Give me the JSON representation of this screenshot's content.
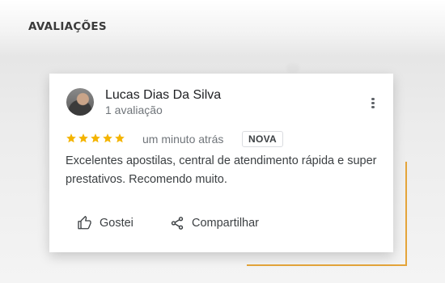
{
  "section": {
    "title": "AVALIAÇÕES"
  },
  "review": {
    "author": "Lucas Dias Da Silva",
    "review_count": "1 avaliação",
    "rating": 5,
    "star_color": "#f4b400",
    "time": "um minuto atrás",
    "badge": "NOVA",
    "text": "Excelentes apostilas, central de atendimento rápida e super prestativos. Recomendo muito.",
    "actions": {
      "like_label": "Gostei",
      "like_icon": "thumbs-up-icon",
      "share_label": "Compartilhar",
      "share_icon": "share-icon"
    },
    "menu_icon": "more-vert-icon"
  },
  "colors": {
    "accent": "#e4a43a"
  }
}
